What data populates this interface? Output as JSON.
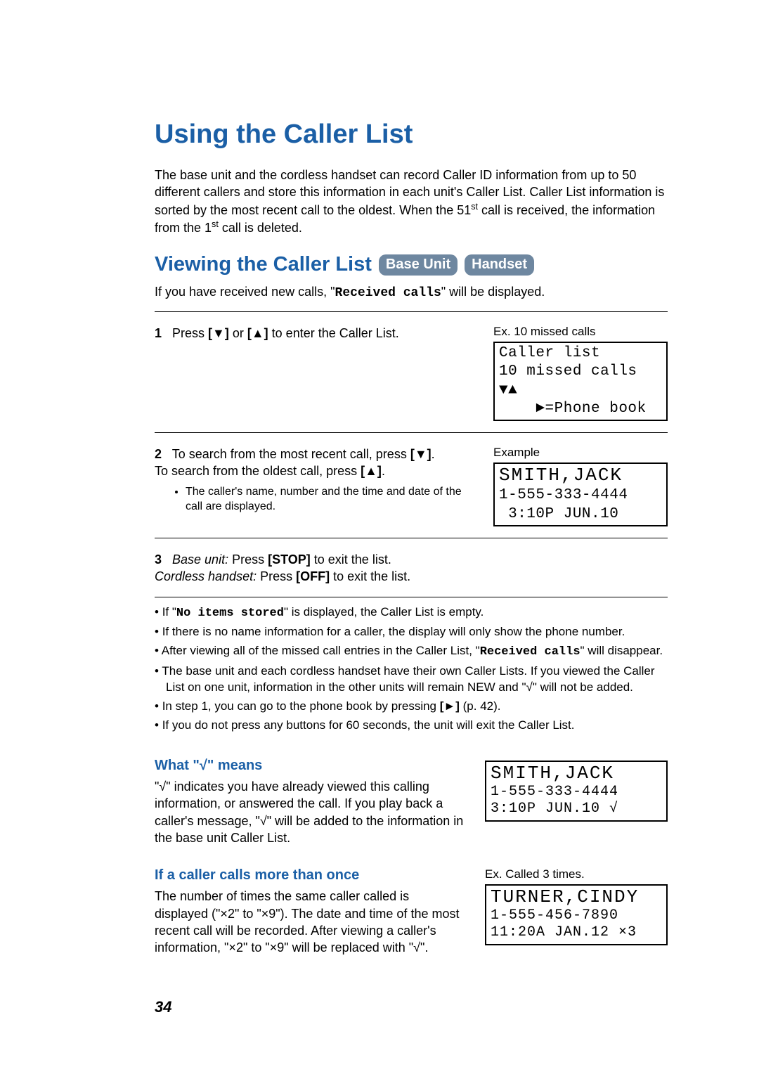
{
  "title": "Using the Caller List",
  "intro_html": "The base unit and the cordless handset can record Caller ID information from up to 50 different callers and store this information in each unit's Caller List. Caller List information is sorted by the most recent call to the oldest. When the 51<sup>st</sup> call is received, the information from the 1<sup>st</sup> call is deleted.",
  "section2": {
    "title": "Viewing the Caller List",
    "badges": [
      "Base Unit",
      "Handset"
    ],
    "subnote_html": "If you have received new calls, \"<span class='mono'>Received calls</span>\" will be displayed."
  },
  "steps": [
    {
      "num": "1",
      "left_html": "Press <span class='brak'>[▼]</span> or <span class='brak'>[▲]</span> to enter the Caller List.",
      "right_label": "Ex. 10 missed calls",
      "lcd": "Caller list\n10 missed calls\n▼▲\n    ►=Phone book"
    },
    {
      "num": "2",
      "left_html": "To search from the most recent call, press <span class='brak'>[▼]</span>.<br>To search from the oldest call, press <span class='brak'>[▲]</span>.",
      "bullets": [
        "The caller's name, number and the time and date of the call are displayed."
      ],
      "right_label": "Example",
      "lcd_name": "SMITH,JACK",
      "lcd_rest": "1-555-333-4444\n 3:10P JUN.10"
    },
    {
      "num": "3",
      "left_html": "<span class='italic'>Base unit:</span> Press <span class='brak'>[STOP]</span> to exit the list.<br><span class='italic'>Cordless handset:</span> Press <span class='brak'>[OFF]</span> to exit the list."
    }
  ],
  "notes": [
    "If \"<span class='mono'>No items stored</span>\" is displayed, the Caller List is empty.",
    "If there is no name information for a caller, the display will only show the phone number.",
    "After viewing all of the missed call entries in the Caller List, \"<span class='mono'>Received calls</span>\" will disappear.",
    "The base unit and each cordless handset have their own Caller Lists. If you viewed the Caller List on one unit, information in the other units will remain NEW and \"√\" will not be added.",
    "In step 1, you can go to the phone book by pressing <span class='brak'>[►]</span> (p. 42).",
    "If you do not press any buttons for 60 seconds, the unit will exit the Caller List."
  ],
  "checkmark": {
    "heading": "What \"√\" means",
    "body": "\"√\" indicates you have already viewed this calling information, or answered the call. If you play back a caller's message, \"√\" will be added to the information in the base unit Caller List.",
    "lcd_name": "SMITH,JACK",
    "lcd_line2": "1-555-333-4444",
    "lcd_line3": " 3:10P JUN.10 √"
  },
  "multi": {
    "heading": "If a caller calls more than once",
    "body": "The number of times the same caller called is displayed (\"×2\" to \"×9\"). The date and time of the most recent call will be recorded. After viewing a caller's information, \"×2\" to \"×9\" will be replaced with \"√\".",
    "rlabel": "Ex. Called 3 times.",
    "lcd_name": "TURNER,CINDY",
    "lcd_line2": "1-555-456-7890",
    "lcd_line3": "11:20A JAN.12 ×3"
  },
  "pagenum": "34"
}
